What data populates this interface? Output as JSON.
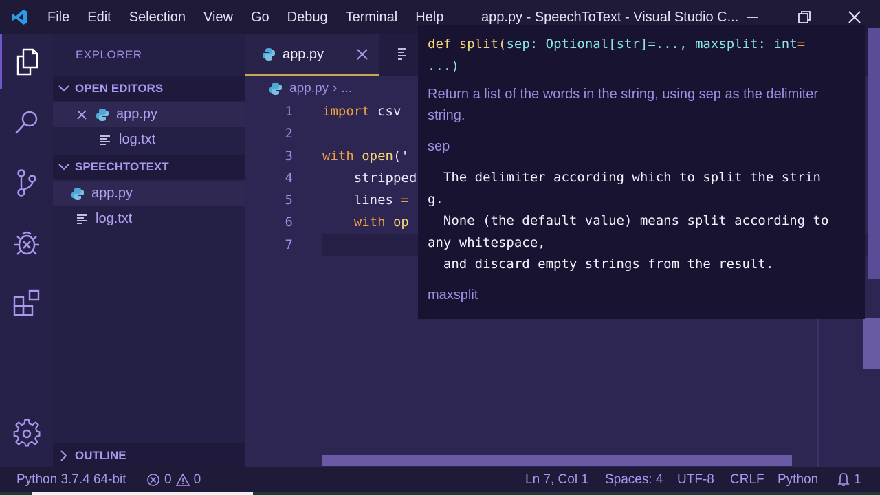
{
  "window": {
    "title": "app.py - SpeechToText - Visual Studio C...",
    "menu": [
      "File",
      "Edit",
      "Selection",
      "View",
      "Go",
      "Debug",
      "Terminal",
      "Help"
    ]
  },
  "activity_bar": [
    "explorer-icon",
    "search-icon",
    "source-control-icon",
    "debug-icon",
    "extensions-icon",
    "settings-gear-icon"
  ],
  "sidebar": {
    "title": "EXPLORER",
    "open_editors": {
      "label": "OPEN EDITORS",
      "items": [
        {
          "name": "app.py",
          "icon": "python-icon"
        },
        {
          "name": "log.txt",
          "icon": "text-file-icon"
        }
      ]
    },
    "project": {
      "label": "SPEECHTOTEXT",
      "items": [
        {
          "name": "app.py",
          "icon": "python-icon"
        },
        {
          "name": "log.txt",
          "icon": "text-file-icon"
        }
      ]
    },
    "outline_label": "OUTLINE"
  },
  "tabs": [
    {
      "label": "app.py",
      "active": true
    }
  ],
  "breadcrumb": {
    "file": "app.py",
    "rest": "..."
  },
  "editor": {
    "line_numbers": [
      "1",
      "2",
      "3",
      "4",
      "5",
      "6",
      "7"
    ],
    "lines": [
      [
        {
          "t": "import",
          "c": "kw"
        },
        {
          "t": " csv",
          "c": ""
        }
      ],
      [],
      [
        {
          "t": "with",
          "c": "kw"
        },
        {
          "t": " ",
          "c": ""
        },
        {
          "t": "open",
          "c": "fn"
        },
        {
          "t": "('",
          "c": ""
        }
      ],
      [
        {
          "t": "    stripped",
          "c": ""
        }
      ],
      [
        {
          "t": "    lines ",
          "c": ""
        },
        {
          "t": "=",
          "c": "kw"
        }
      ],
      [
        {
          "t": "    ",
          "c": ""
        },
        {
          "t": "with",
          "c": "kw"
        },
        {
          "t": " op",
          "c": "fn"
        }
      ],
      []
    ],
    "current_line": 7
  },
  "hover": {
    "signature": {
      "def": "def",
      "name": "split",
      "open": "(",
      "params": "sep: Optional[str]=..., maxsplit: int",
      "eq": "=",
      "rest": "...)"
    },
    "description": "Return a list of the words in the string, using sep as the delimiter string.",
    "param1": "sep",
    "param1_doc": [
      "  The delimiter according which to split the strin",
      "g.",
      "  None (the default value) means split according to",
      "any whitespace,",
      "  and discard empty strings from the result."
    ],
    "param2": "maxsplit"
  },
  "statusbar": {
    "interpreter": "Python 3.7.4 64-bit",
    "errors": "0",
    "warnings": "0",
    "position": "Ln 7, Col 1",
    "spaces": "Spaces: 4",
    "encoding": "UTF-8",
    "eol": "CRLF",
    "language": "Python",
    "notifications": "1"
  }
}
